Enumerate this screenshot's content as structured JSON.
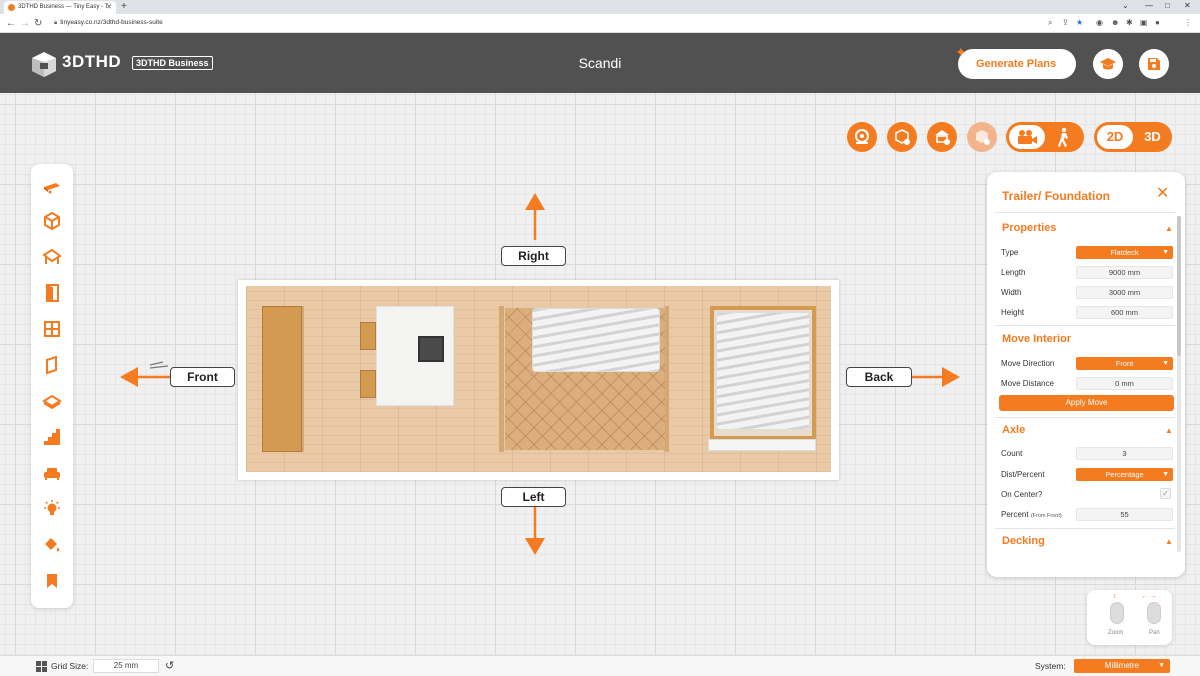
{
  "browser": {
    "tab_title": "3DTHD Business — Tiny Easy - T",
    "url": "tinyeasy.co.nz/3dthd-business-suite"
  },
  "header": {
    "logo_text": "3DTHD",
    "badge": "3DTHD Business",
    "project_title": "Scandi",
    "generate_label": "Generate Plans"
  },
  "view_toggle": {
    "mode_2d": "2D",
    "mode_3d": "3D",
    "active": "2D"
  },
  "plan": {
    "labels": {
      "right": "Right",
      "front": "Front",
      "back": "Back",
      "left": "Left"
    }
  },
  "panel": {
    "title": "Trailer/ Foundation",
    "properties": {
      "title": "Properties",
      "type_label": "Type",
      "type_value": "Flatdeck",
      "length_label": "Length",
      "length_value": "9000 mm",
      "width_label": "Width",
      "width_value": "3000 mm",
      "height_label": "Height",
      "height_value": "600 mm"
    },
    "move_interior": {
      "title": "Move Interior",
      "direction_label": "Move Direction",
      "direction_value": "Front",
      "distance_label": "Move Distance",
      "distance_value": "0 mm",
      "apply_label": "Apply Move"
    },
    "axle": {
      "title": "Axle",
      "count_label": "Count",
      "count_value": "3",
      "dist_label": "Dist/Percent",
      "dist_value": "Percentage",
      "center_label": "On Center?",
      "percent_label": "Percent",
      "percent_sub": "(From Front)",
      "percent_value": "55"
    },
    "decking": {
      "title": "Decking"
    }
  },
  "nav_help": {
    "zoom": "Zoom",
    "pan": "Pan"
  },
  "status": {
    "grid_label": "Grid Size:",
    "grid_value": "25 mm",
    "system_label": "System:",
    "system_value": "Millimetre"
  },
  "colors": {
    "accent": "#f47b20",
    "header_bg": "#515151"
  },
  "toolbar_icons": [
    "trailer-icon",
    "cube-icon",
    "roof-icon",
    "door-icon",
    "window-icon",
    "panel-icon",
    "floor-icon",
    "stairs-icon",
    "sofa-icon",
    "light-icon",
    "paint-icon",
    "bookmark-icon"
  ]
}
